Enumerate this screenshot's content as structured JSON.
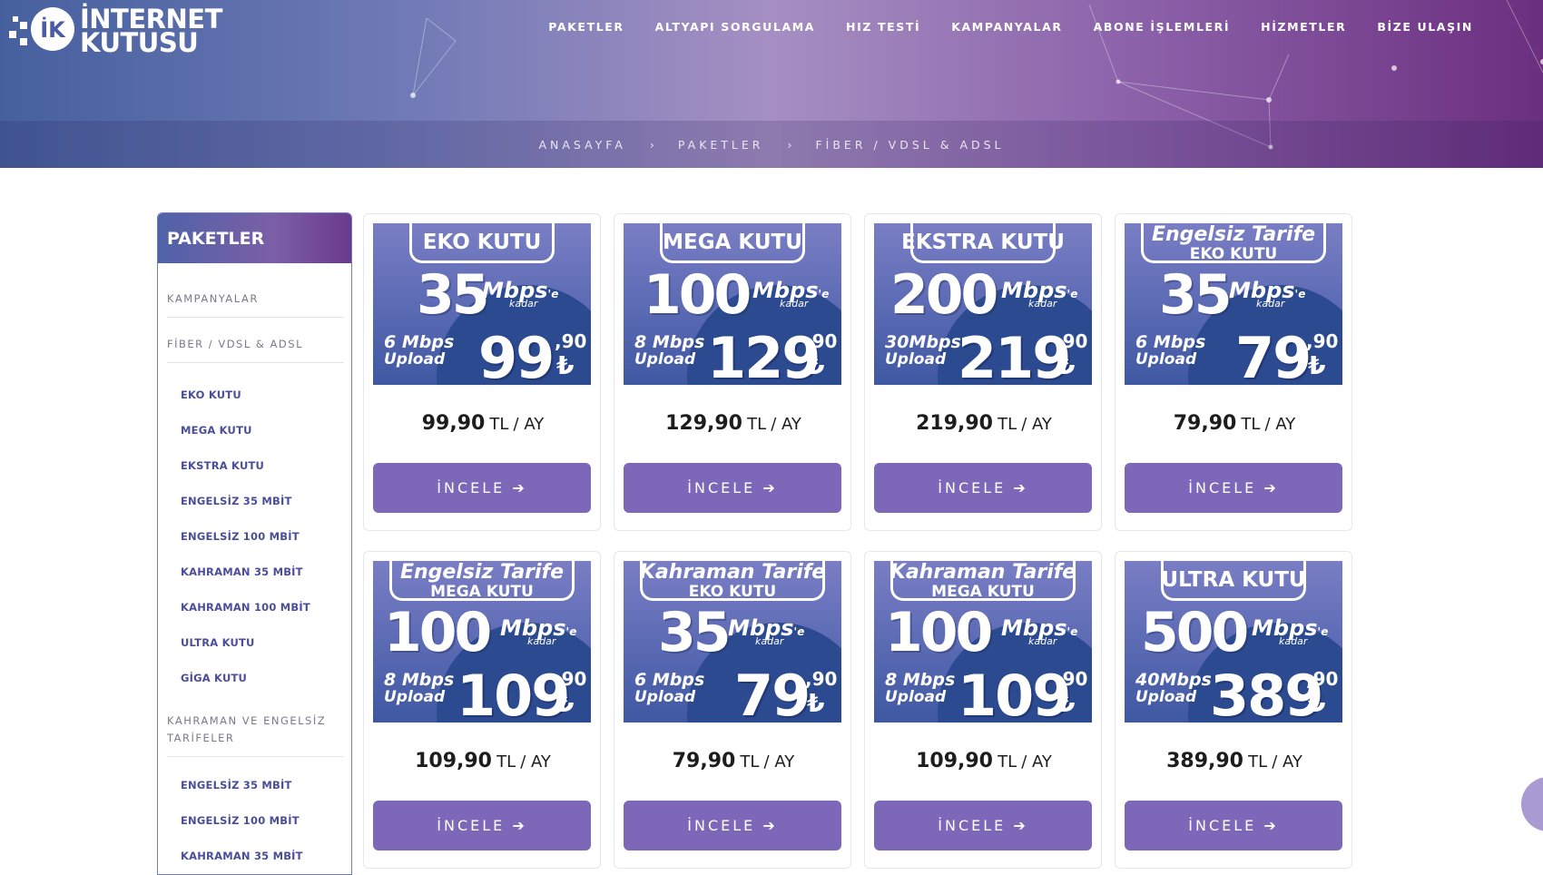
{
  "header": {
    "logo_line1": "İNTERNET",
    "logo_line2": "KUTUSU",
    "nav": [
      "PAKETLER",
      "ALTYAPI SORGULAMA",
      "HIZ TESTİ",
      "KAMPANYALAR",
      "ABONE İŞLEMLERİ",
      "HİZMETLER",
      "BİZE ULAŞIN"
    ],
    "breadcrumb": [
      "ANASAYFA",
      "PAKETLER",
      "FİBER / VDSL & ADSL"
    ],
    "breadcrumb_sep": "›"
  },
  "sidebar": {
    "title": "PAKETLER",
    "sections": [
      {
        "label": "KAMPANYALAR"
      },
      {
        "label": "FİBER / VDSL & ADSL"
      },
      {
        "label": "KAHRAMAN VE ENGELSİZ TARİFELER"
      }
    ],
    "fiber_items": [
      "EKO KUTU",
      "MEGA KUTU",
      "EKSTRA KUTU",
      "ENGELSİZ 35 MBİT",
      "ENGELSİZ 100 MBİT",
      "KAHRAMAN 35 MBİT",
      "KAHRAMAN 100 MBİT",
      "ULTRA KUTU",
      "GİGA KUTU"
    ],
    "tariff_items": [
      "ENGELSİZ 35 MBİT",
      "ENGELSİZ 100 MBİT",
      "KAHRAMAN 35 MBİT"
    ]
  },
  "common": {
    "mbps_word": "Mbps",
    "mbps_suffix": "'e",
    "kadar": "kadar",
    "upload_word": "Upload",
    "cents": ",90",
    "lira": "₺",
    "tl": "TL",
    "per": "/ AY",
    "button_label": "İNCELE ➔"
  },
  "cards": [
    {
      "title": "EKO KUTU",
      "speed": "35",
      "upload": "6 Mbps",
      "price": "99",
      "monthly": "99,90"
    },
    {
      "title": "MEGA KUTU",
      "speed": "100",
      "upload": "8 Mbps",
      "price": "129",
      "monthly": "129,90"
    },
    {
      "title": "EKSTRA KUTU",
      "speed": "200",
      "upload": "30Mbps",
      "price": "219",
      "monthly": "219,90"
    },
    {
      "title": "Engelsiz Tarife",
      "subtitle": "EKO KUTU",
      "speed": "35",
      "upload": "6 Mbps",
      "price": "79",
      "monthly": "79,90"
    },
    {
      "title": "Engelsiz Tarife",
      "subtitle": "MEGA KUTU",
      "speed": "100",
      "upload": "8 Mbps",
      "price": "109",
      "monthly": "109,90"
    },
    {
      "title": "Kahraman Tarife",
      "subtitle": "EKO KUTU",
      "speed": "35",
      "upload": "6 Mbps",
      "price": "79",
      "monthly": "79,90"
    },
    {
      "title": "Kahraman Tarife",
      "subtitle": "MEGA KUTU",
      "speed": "100",
      "upload": "8 Mbps",
      "price": "109",
      "monthly": "109,90"
    },
    {
      "title": "ULTRA KUTU",
      "speed": "500",
      "upload": "40Mbps",
      "price": "389",
      "monthly": "389,90"
    }
  ],
  "colors": {
    "button": "#7d67b8",
    "sidebar_link": "#4a4e9a",
    "header_start": "#46609e",
    "header_end": "#6b2f7f"
  }
}
